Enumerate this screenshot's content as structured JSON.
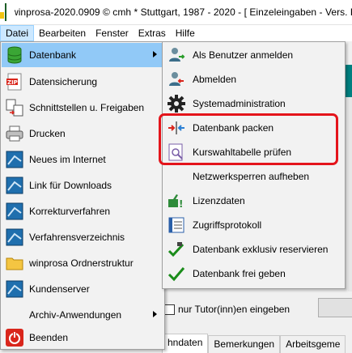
{
  "window": {
    "title": "winprosa-2020.0909 © cmh * Stuttgart, 1987 - 2020 - [ Einzeleingaben - Vers. R"
  },
  "menubar": {
    "items": [
      {
        "label": "Datei"
      },
      {
        "label": "Bearbeiten"
      },
      {
        "label": "Fenster"
      },
      {
        "label": "Extras"
      },
      {
        "label": "Hilfe"
      }
    ]
  },
  "datei_menu": {
    "items": [
      {
        "label": "Datenbank",
        "icon": "database-icon",
        "submenu": true
      },
      {
        "label": "Datensicherung",
        "icon": "zip-icon"
      },
      {
        "label": "Schnittstellen u. Freigaben",
        "icon": "exchange-icon"
      },
      {
        "label": "Drucken",
        "icon": "printer-icon"
      },
      {
        "label": "Neues im Internet",
        "icon": "web-app-icon"
      },
      {
        "label": "Link für Downloads",
        "icon": "web-app-icon"
      },
      {
        "label": "Korrekturverfahren",
        "icon": "web-app-icon"
      },
      {
        "label": "Verfahrensverzeichnis",
        "icon": "web-app-icon"
      },
      {
        "label": "winprosa Ordnerstruktur",
        "icon": "folder-icon"
      },
      {
        "label": "Kundenserver",
        "icon": "web-app-icon"
      },
      {
        "label": "Archiv-Anwendungen",
        "icon": "none",
        "submenu": true
      },
      {
        "label": "Beenden",
        "icon": "power-icon"
      }
    ]
  },
  "datenbank_submenu": {
    "items": [
      {
        "label": "Als Benutzer anmelden",
        "icon": "login-user-icon"
      },
      {
        "label": "Abmelden",
        "icon": "logout-user-icon"
      },
      {
        "label": "Systemadministration",
        "icon": "gear-icon"
      },
      {
        "label": "Datenbank packen",
        "icon": "compress-arrows-icon"
      },
      {
        "label": "Kurswahltabelle prüfen",
        "icon": "inspect-document-icon"
      },
      {
        "label": "Netzwerksperren aufheben",
        "icon": "none"
      },
      {
        "label": "Lizenzdaten",
        "icon": "license-icon"
      },
      {
        "label": "Zugriffsprotokoll",
        "icon": "log-book-icon"
      },
      {
        "label": "Datenbank exklusiv reservieren",
        "icon": "checkmark-lock-icon"
      },
      {
        "label": "Datenbank frei geben",
        "icon": "checkmark-icon"
      }
    ]
  },
  "background": {
    "checkbox_label": "nur Tutor(inn)en eingeben",
    "tabs": [
      {
        "label": "hndaten"
      },
      {
        "label": "Bemerkungen"
      },
      {
        "label": "Arbeitsgeme"
      }
    ]
  },
  "colors": {
    "highlight": "#91c9f7",
    "menu_active": "#cce8ff",
    "annotation_box": "#e4141b"
  }
}
